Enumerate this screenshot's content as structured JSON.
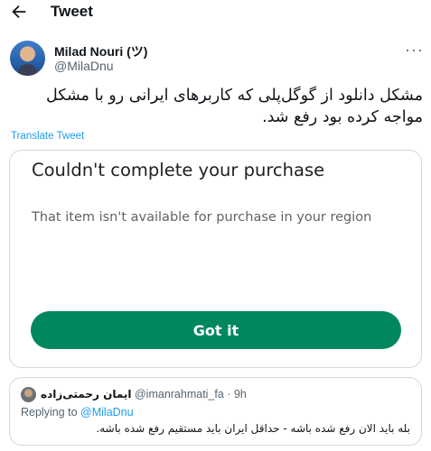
{
  "header": {
    "title": "Tweet",
    "back_icon": "arrow-left-icon"
  },
  "tweet": {
    "author_name": "Milad Nouri (ツ)",
    "author_handle": "@MilaDnu",
    "more_icon": "more-horizontal-icon",
    "more_glyph": "···",
    "text": "مشکل دانلود از گوگل‌پلی که کاربرهای ایرانی رو با مشکل مواجه کرده بود رفع شد.",
    "translate_label": "Translate Tweet"
  },
  "media": {
    "title": "Couldn't complete your purchase",
    "message": "That item isn't available for purchase in your region",
    "button_label": "Got it",
    "button_color": "#01875f"
  },
  "quote": {
    "name": "ایمان رحمتی‌زاده",
    "handle": "@imanrahmati_fa",
    "separator": "·",
    "time": "9h",
    "replying_prefix": "Replying to",
    "replying_handle": "@MilaDnu",
    "text": "بله باید الان رفع شده باشه - حداقل ایران باید مستقیم رفع شده باشه."
  },
  "colors": {
    "link": "#1d9bf0",
    "secondary_text": "#536471",
    "border": "#cfd9de"
  }
}
